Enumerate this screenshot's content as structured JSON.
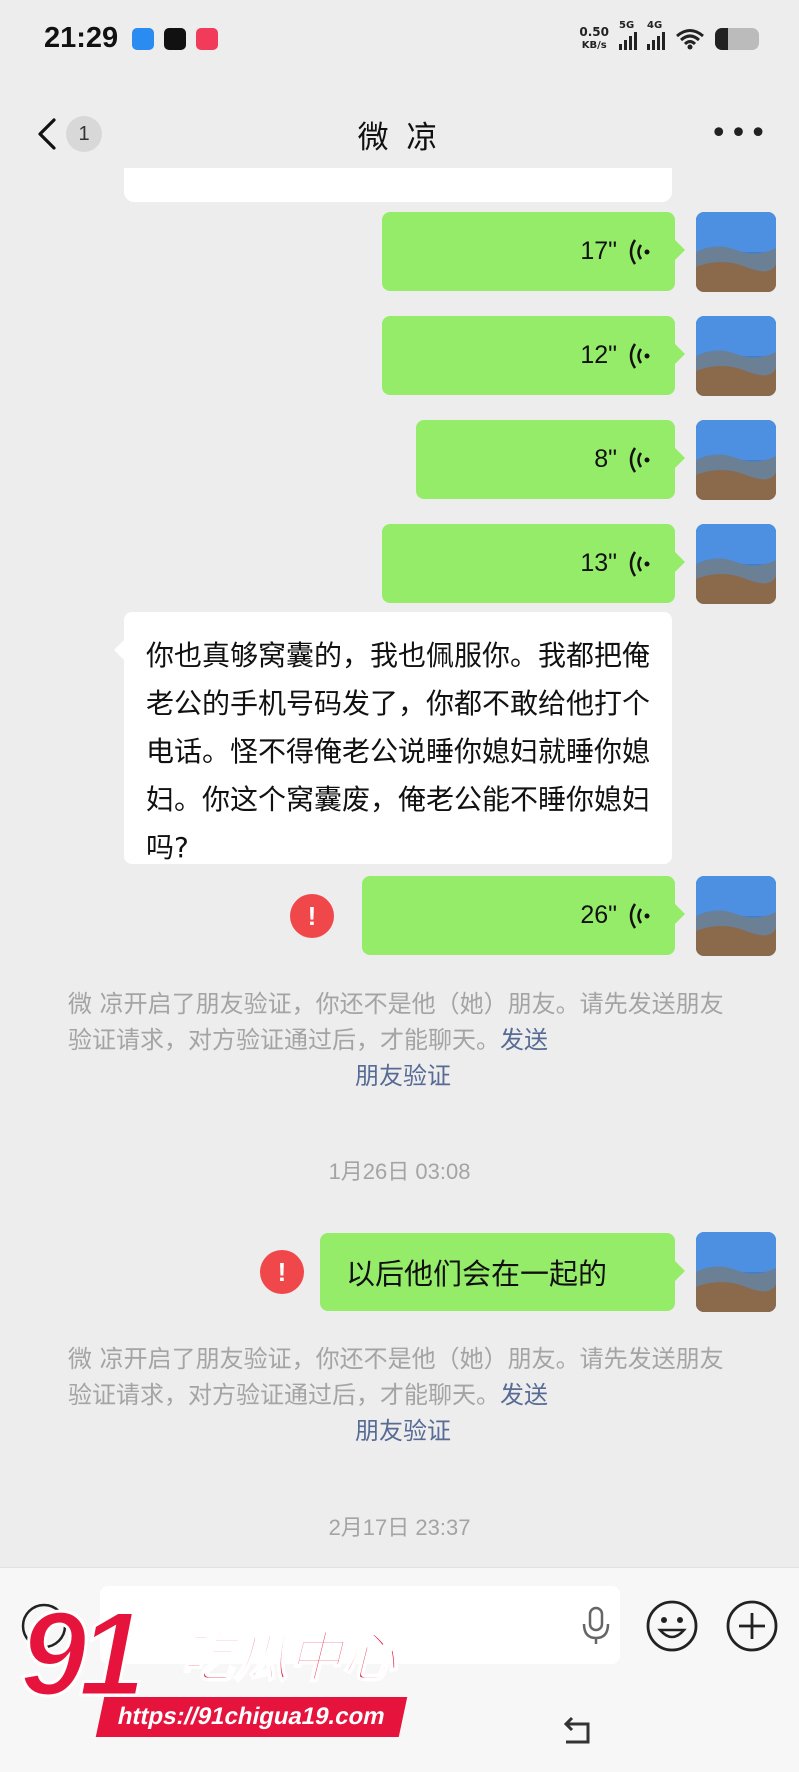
{
  "status": {
    "time": "21:29",
    "net_speed_value": "0.50",
    "net_speed_unit": "KB/s",
    "sig1_label": "5G",
    "sig2_label": "4G",
    "battery_percent": 30
  },
  "nav": {
    "unread_count": "1",
    "title": "微 凉"
  },
  "messages": {
    "voice_1": "17\"",
    "voice_2": "12\"",
    "voice_3": "8\"",
    "voice_4": "13\"",
    "incoming_text": "你也真够窝囊的，我也佩服你。我都把俺老公的手机号码发了，你都不敢给他打个电话。怪不得俺老公说睡你媳妇就睡你媳妇。你这个窝囊废，俺老公能不睡你媳妇吗?",
    "voice_5": "26\"",
    "error_mark": "!",
    "system_notice_1": "微 凉开启了朋友验证，你还不是他（她）朋友。请先发送朋友验证请求，对方验证通过后，才能聊天。",
    "system_link_1a": "发送",
    "system_link_1b": "朋友验证",
    "timestamp_1": "1月26日 03:08",
    "outgoing_text": "以后他们会在一起的",
    "system_notice_2": "微 凉开启了朋友验证，你还不是他（她）朋友。请先发送朋友验证请求，对方验证通过后，才能聊天。",
    "system_link_2a": "发送",
    "system_link_2b": "朋友验证",
    "timestamp_2": "2月17日 23:37"
  },
  "watermark": {
    "number": "91",
    "brand": "吃瓜中心",
    "url": "https://91chigua19.com"
  },
  "colors": {
    "outgoing_bubble": "#95ec69",
    "incoming_bubble": "#ffffff",
    "background": "#ededed",
    "error": "#f0474b",
    "link": "#576b95",
    "watermark": "#e6133c"
  }
}
